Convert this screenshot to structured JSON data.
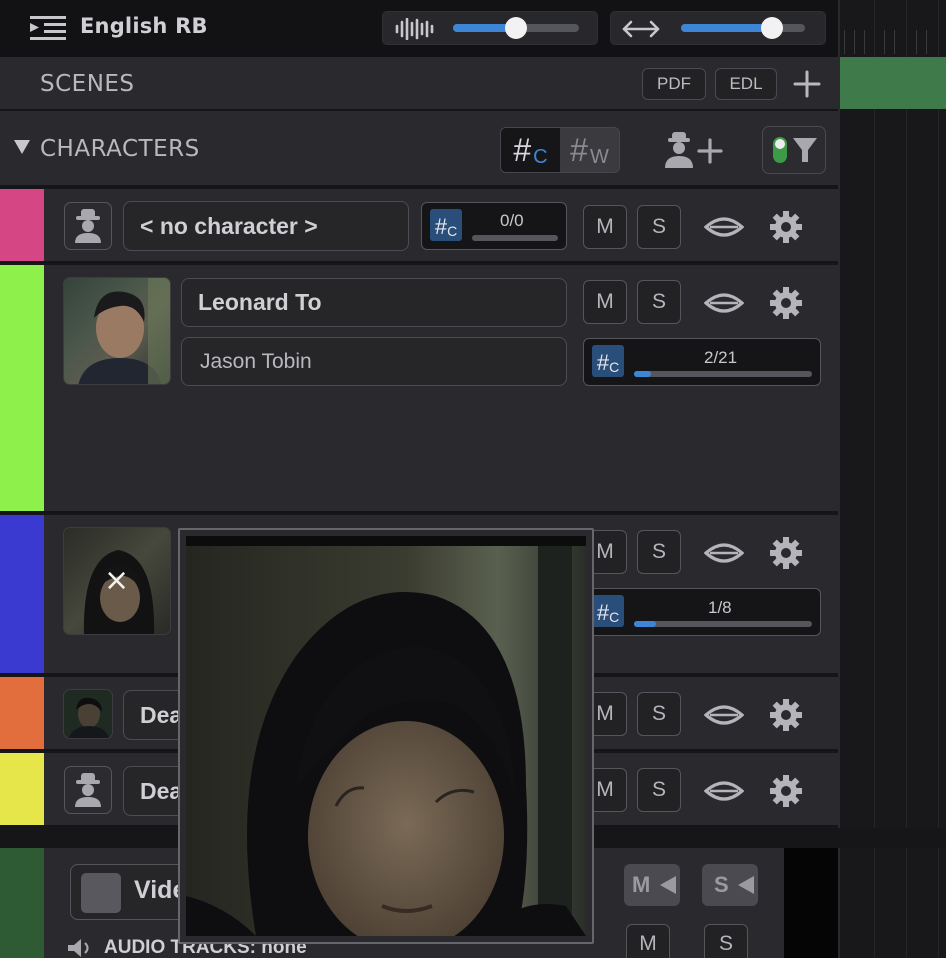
{
  "header": {
    "track_title": "English RB",
    "volume_level": 0.5,
    "zoom_level": 0.73
  },
  "scenes": {
    "label": "SCENES",
    "pdf_label": "PDF",
    "edl_label": "EDL",
    "add_label": "+"
  },
  "characters": {
    "label": "CHARACTERS",
    "toggle_char": {
      "hash": "#",
      "sub": "C"
    },
    "toggle_word": {
      "hash": "#",
      "sub": "W"
    },
    "rows": [
      {
        "name": "< no character >",
        "count": "0/0",
        "progress": 0.0,
        "color": "#d44684",
        "mute": "M",
        "solo": "S"
      },
      {
        "name": "Leonard To",
        "actor": "Jason Tobin",
        "count": "2/21",
        "progress": 0.095,
        "color": "#8ef04a",
        "mute": "M",
        "solo": "S"
      },
      {
        "name": "",
        "count": "1/8",
        "progress": 0.125,
        "color": "#3a3ad0",
        "mute": "M",
        "solo": "S"
      },
      {
        "name": "Dea",
        "color": "#e26e3e",
        "mute": "M",
        "solo": "S"
      },
      {
        "name": "Dea",
        "color": "#e6e64a",
        "mute": "M",
        "solo": "S"
      }
    ]
  },
  "bottom": {
    "video_label": "Vide",
    "audio_label": "AUDIO TRACKS: none",
    "video_mute": "M",
    "video_solo": "S",
    "audio_mute": "M",
    "audio_solo": "S"
  },
  "popup": {
    "close_glyph": "×"
  },
  "colors": {
    "accent": "#3d86d6",
    "panel": "#2a2a2e",
    "timeline_clip": "#3e7a4a"
  }
}
